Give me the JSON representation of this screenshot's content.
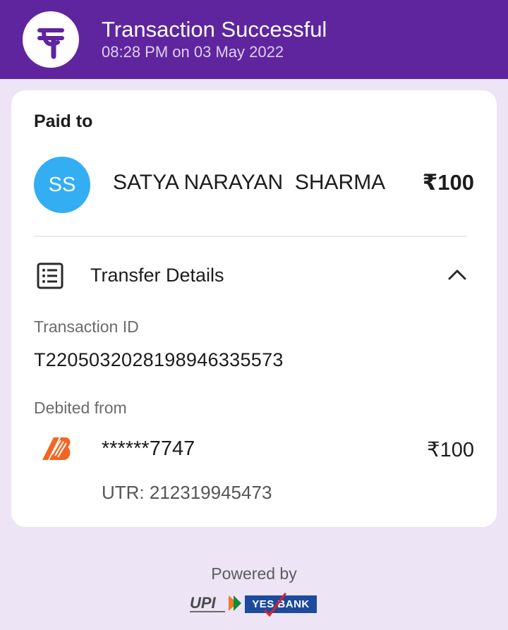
{
  "header": {
    "title": "Transaction Successful",
    "time": "08:28 PM on 03 May 2022",
    "app_logo": "phonepe-logo"
  },
  "paid_to": {
    "label": "Paid to",
    "avatar_initials": "SS",
    "payee_name": "SATYA NARAYAN  SHARMA",
    "amount": "₹100"
  },
  "transfer_details": {
    "label": "Transfer Details",
    "icon": "list-icon",
    "toggle_icon": "chevron-up-icon",
    "transaction_id_label": "Transaction ID",
    "transaction_id": "T2205032028198946335573",
    "debited_from_label": "Debited from",
    "bank_icon": "bank-of-baroda-logo",
    "account": "******7747",
    "debit_amount": "₹100",
    "utr": "UTR: 212319945473"
  },
  "footer": {
    "powered_by": "Powered by",
    "partner_logos": [
      "UPI",
      "YES BANK"
    ],
    "upi_text": "UPI",
    "yes_bank_text": "YES BANK"
  },
  "colors": {
    "header_bg": "#5f259f",
    "page_bg": "#ede4f6",
    "avatar_bg": "#33aef3",
    "bank_orange": "#f26522"
  }
}
